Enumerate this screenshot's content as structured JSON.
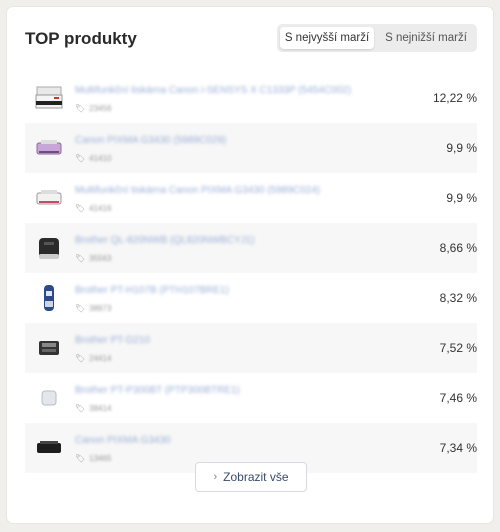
{
  "widget": {
    "title": "TOP produkty",
    "toggle": {
      "active": "S nejvyšší marží",
      "inactive": "S nejnižší marží"
    },
    "show_all": "Zobrazit vše"
  },
  "products": [
    {
      "name": "Multifunkční tiskárna Canon i-SENSYS X C1333P (5454C002)",
      "code": "23456",
      "margin": "12,22 %",
      "icon": "laser-mfp-printer-icon"
    },
    {
      "name": "Canon PIXMA G3430 (5989C029)",
      "code": "41410",
      "margin": "9,9 %",
      "icon": "inkjet-printer-pink-icon"
    },
    {
      "name": "Multifunkční tiskárna Canon PIXMA G3430 (5989C024)",
      "code": "41416",
      "margin": "9,9 %",
      "icon": "inkjet-printer-white-icon"
    },
    {
      "name": "Brother QL-820NWB (QL820NWBCYJ1)",
      "code": "35563",
      "margin": "8,66 %",
      "icon": "label-printer-icon"
    },
    {
      "name": "Brother PT-H107B (PTH107BRE1)",
      "code": "38973",
      "margin": "8,32 %",
      "icon": "handheld-labeler-icon"
    },
    {
      "name": "Brother PT-D210",
      "code": "24414",
      "margin": "7,52 %",
      "icon": "desktop-labeler-icon"
    },
    {
      "name": "Brother PT-P300BT (PTP300BTRE1)",
      "code": "38414",
      "margin": "7,46 %",
      "icon": "cube-labeler-icon"
    },
    {
      "name": "Canon PIXMA G3430",
      "code": "13465",
      "margin": "7,34 %",
      "icon": "ink-tank-printer-icon"
    }
  ]
}
